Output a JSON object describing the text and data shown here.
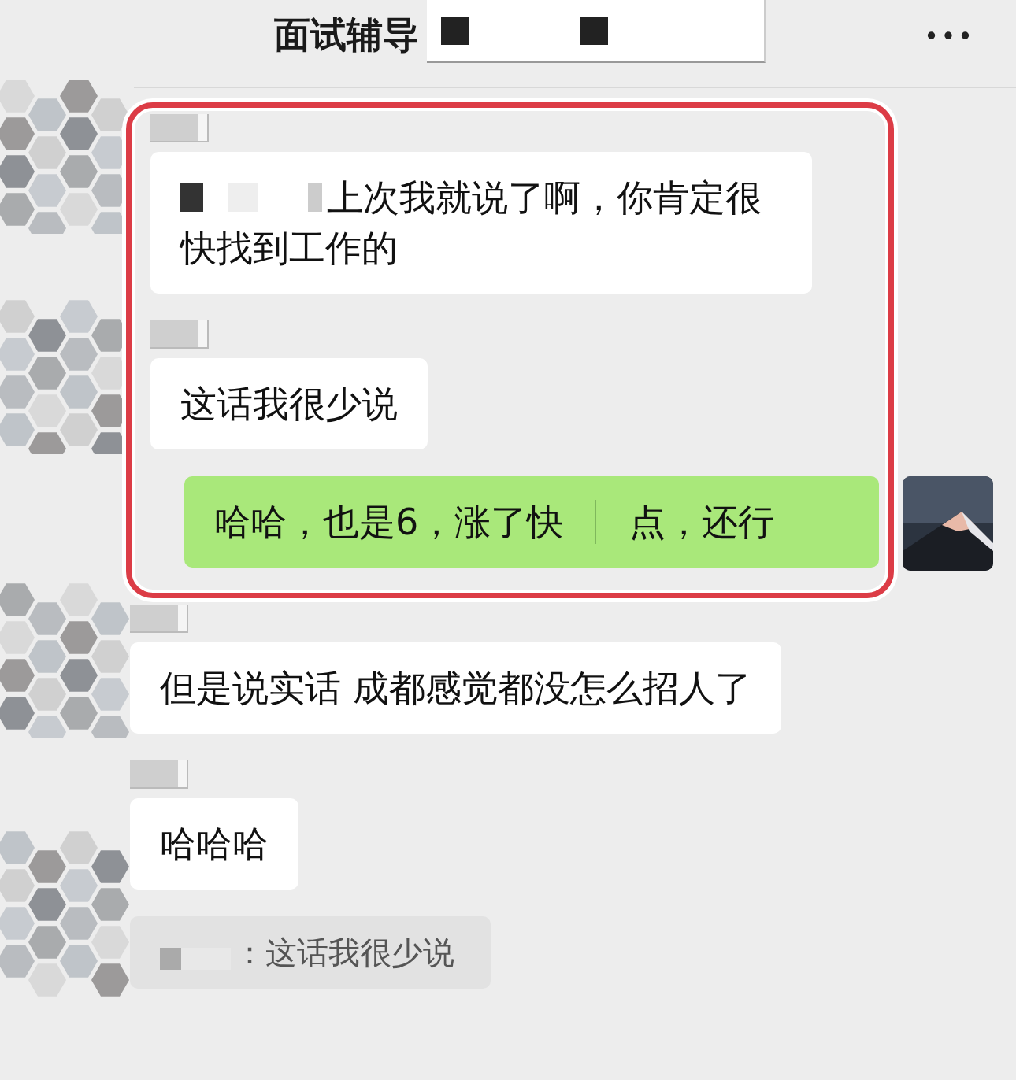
{
  "header": {
    "title": "面试辅导"
  },
  "messages": [
    {
      "kind": "left",
      "highlighted": true,
      "segments": [
        {
          "kind": "redacted"
        },
        {
          "kind": "text",
          "text": "上次我就说了啊，你肯定很快找到工作的"
        }
      ]
    },
    {
      "kind": "left",
      "highlighted": true,
      "segments": [
        {
          "kind": "text",
          "text": "这话我很少说"
        }
      ]
    },
    {
      "kind": "right",
      "highlighted": true,
      "segments": [
        {
          "kind": "text",
          "text": "哈哈，也是6，涨了快"
        },
        {
          "kind": "redacted"
        },
        {
          "kind": "text",
          "text": "点，还行"
        }
      ]
    },
    {
      "kind": "left",
      "highlighted": false,
      "segments": [
        {
          "kind": "text",
          "text": "但是说实话  成都感觉都没怎么招人了"
        }
      ]
    },
    {
      "kind": "left",
      "highlighted": false,
      "segments": [
        {
          "kind": "text",
          "text": "哈哈哈"
        }
      ]
    },
    {
      "kind": "quote",
      "highlighted": false,
      "segments": [
        {
          "kind": "redacted"
        },
        {
          "kind": "text",
          "text": "：这话我很少说"
        }
      ]
    }
  ]
}
